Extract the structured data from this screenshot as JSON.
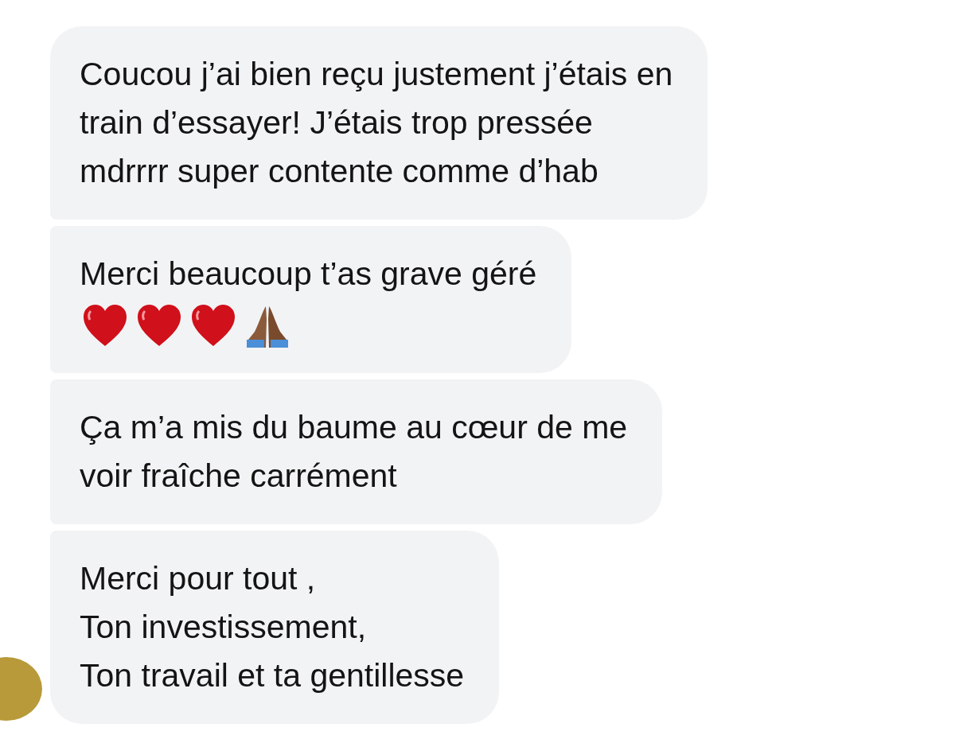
{
  "messages": [
    {
      "lines": [
        "Coucou j’ai bien reçu justement j’étais en",
        "train d’essayer! J’étais trop pressée",
        "mdrrrr super contente comme d’hab"
      ]
    },
    {
      "lines": [
        "Merci beaucoup t’as grave géré"
      ],
      "emoji": [
        {
          "kind": "heart"
        },
        {
          "kind": "heart"
        },
        {
          "kind": "heart"
        },
        {
          "kind": "praying-hands"
        }
      ]
    },
    {
      "lines": [
        "Ça m’a mis du baume au cœur de me",
        "voir fraîche carrément"
      ]
    },
    {
      "lines": [
        "Merci pour tout ,",
        "Ton investissement,",
        "Ton travail et ta gentillesse"
      ],
      "avatar": true
    }
  ]
}
